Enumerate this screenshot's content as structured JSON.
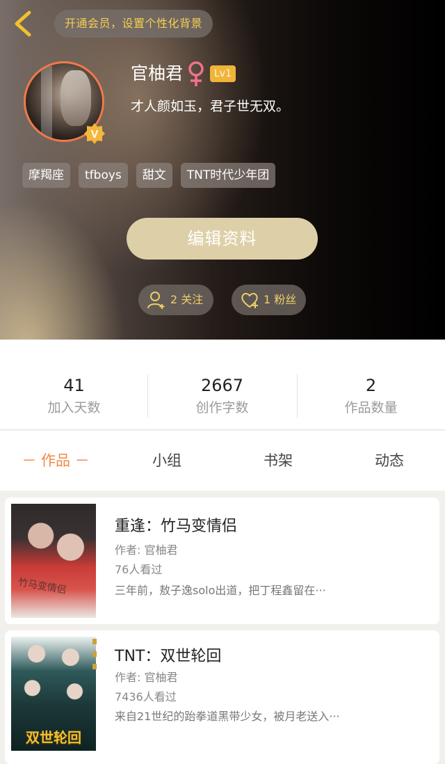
{
  "header": {
    "vip_banner": "开通会员，设置个性化背景",
    "nickname": "官柚君",
    "gender": "female",
    "level": "Lv1",
    "bio": "才人颜如玉，君子世无双。",
    "tags": [
      "摩羯座",
      "tfboys",
      "甜文",
      "TNT时代少年团"
    ],
    "edit_button": "编辑资料",
    "following": "2 关注",
    "followers": "1 粉丝",
    "colors": {
      "accent": "#f08a43",
      "gold": "#f4cf52",
      "edit_button": "#ddd0a8"
    }
  },
  "stats": [
    {
      "value": "41",
      "label": "加入天数"
    },
    {
      "value": "2667",
      "label": "创作字数"
    },
    {
      "value": "2",
      "label": "作品数量"
    }
  ],
  "tabs": [
    {
      "label": "－ 作品 －",
      "active": true
    },
    {
      "label": "小组",
      "active": false
    },
    {
      "label": "书架",
      "active": false
    },
    {
      "label": "动态",
      "active": false
    }
  ],
  "works": [
    {
      "title": "重逢：竹马变情侣",
      "author": "作者: 官柚君",
      "views": "76人看过",
      "desc": "三年前，敖子逸solo出道，把丁程鑫留在···",
      "cover_text": "竹马变情侣"
    },
    {
      "title": "TNT：双世轮回",
      "author": "作者: 官柚君",
      "views": "7436人看过",
      "desc": "来自21世纪的跆拳道黑带少女，被月老送入···",
      "cover_text": "双世轮回"
    }
  ]
}
